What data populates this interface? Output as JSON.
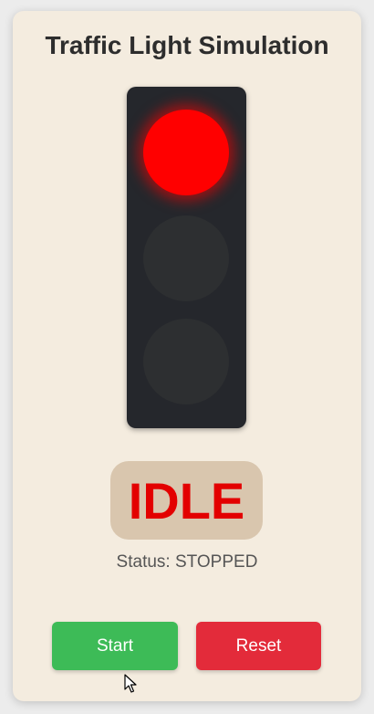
{
  "app": {
    "title": "Traffic Light Simulation"
  },
  "traffic_light": {
    "active_lamp": "red",
    "lamps": [
      {
        "name": "red",
        "on": true,
        "color": "#ff0000"
      },
      {
        "name": "yellow",
        "on": false,
        "color": "#2d2f31"
      },
      {
        "name": "green",
        "on": false,
        "color": "#2d2f31"
      }
    ]
  },
  "state": {
    "label": "IDLE",
    "color": "#e30000"
  },
  "status": {
    "text": "Status: STOPPED"
  },
  "controls": {
    "start_label": "Start",
    "reset_label": "Reset",
    "start_color": "#3dbb57",
    "reset_color": "#e32b3a"
  },
  "cursor": {
    "icon": "mouse-pointer-icon"
  }
}
